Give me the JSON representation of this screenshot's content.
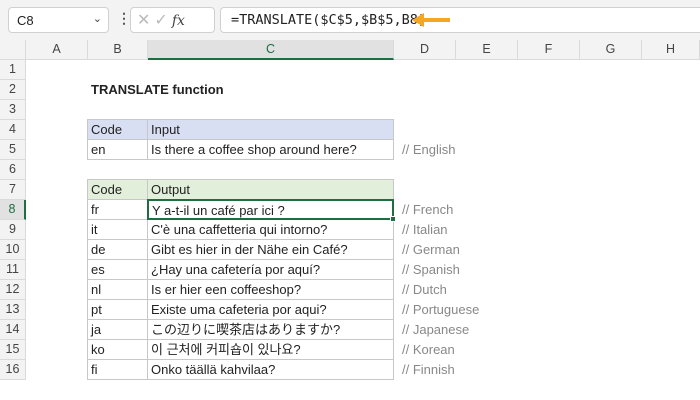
{
  "toolbar": {
    "name_box": "C8",
    "formula": "=TRANSLATE($C$5,$B$5,B8)",
    "fx_label": "fx",
    "accent": "#f5a623"
  },
  "columns": [
    "A",
    "B",
    "C",
    "D",
    "E",
    "F",
    "G",
    "H"
  ],
  "rows": [
    "1",
    "2",
    "3",
    "4",
    "5",
    "6",
    "7",
    "8",
    "9",
    "10",
    "11",
    "12",
    "13",
    "14",
    "15",
    "16"
  ],
  "title": "TRANSLATE function",
  "input_table": {
    "headers": [
      "Code",
      "Input"
    ],
    "row": {
      "code": "en",
      "text": "Is there a coffee shop around here?",
      "comment": "// English"
    }
  },
  "output_table": {
    "headers": [
      "Code",
      "Output"
    ],
    "rows": [
      {
        "code": "fr",
        "text": "Y a-t-il un café par ici ?",
        "comment": "// French"
      },
      {
        "code": "it",
        "text": "C'è una caffetteria qui intorno?",
        "comment": "// Italian"
      },
      {
        "code": "de",
        "text": "Gibt es hier in der Nähe ein Café?",
        "comment": "// German"
      },
      {
        "code": "es",
        "text": "¿Hay una cafetería por aquí?",
        "comment": "// Spanish"
      },
      {
        "code": "nl",
        "text": "Is er hier een coffeeshop?",
        "comment": "// Dutch"
      },
      {
        "code": "pt",
        "text": "Existe uma cafeteria por aqui?",
        "comment": "// Portuguese"
      },
      {
        "code": "ja",
        "text": "この辺りに喫茶店はありますか?",
        "comment": "// Japanese"
      },
      {
        "code": "ko",
        "text": "이 근처에 커피숍이 있나요?",
        "comment": "// Korean"
      },
      {
        "code": "fi",
        "text": "Onko täällä kahvilaa?",
        "comment": "// Finnish"
      }
    ]
  }
}
